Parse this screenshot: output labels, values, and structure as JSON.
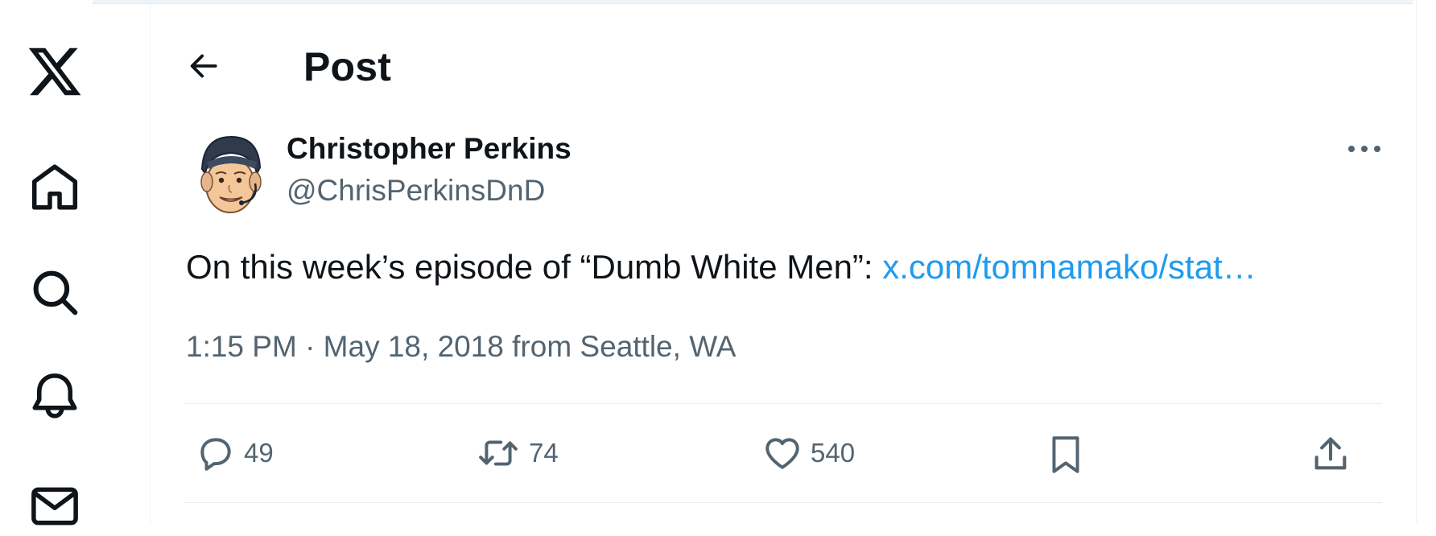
{
  "nav": {
    "items": [
      {
        "icon": "x-logo-icon"
      },
      {
        "icon": "home-icon"
      },
      {
        "icon": "search-icon"
      },
      {
        "icon": "notifications-bell-icon"
      },
      {
        "icon": "messages-mail-icon"
      }
    ]
  },
  "header": {
    "title": "Post",
    "back_icon": "arrow-left-icon"
  },
  "tweet": {
    "author_name": "Christopher Perkins",
    "author_handle": "@ChrisPerkinsDnD",
    "text": "On this week’s episode of “Dumb White Men”: ",
    "link": "x.com/tomnamako/stat…",
    "meta": "1:15 PM · May 18, 2018 from Seattle, WA"
  },
  "actions": {
    "reply_count": "49",
    "repost_count": "74",
    "like_count": "540"
  },
  "colors": {
    "text": "#0f1419",
    "secondary": "#536471",
    "link": "#1d9bf0",
    "border": "#eff3f4"
  }
}
